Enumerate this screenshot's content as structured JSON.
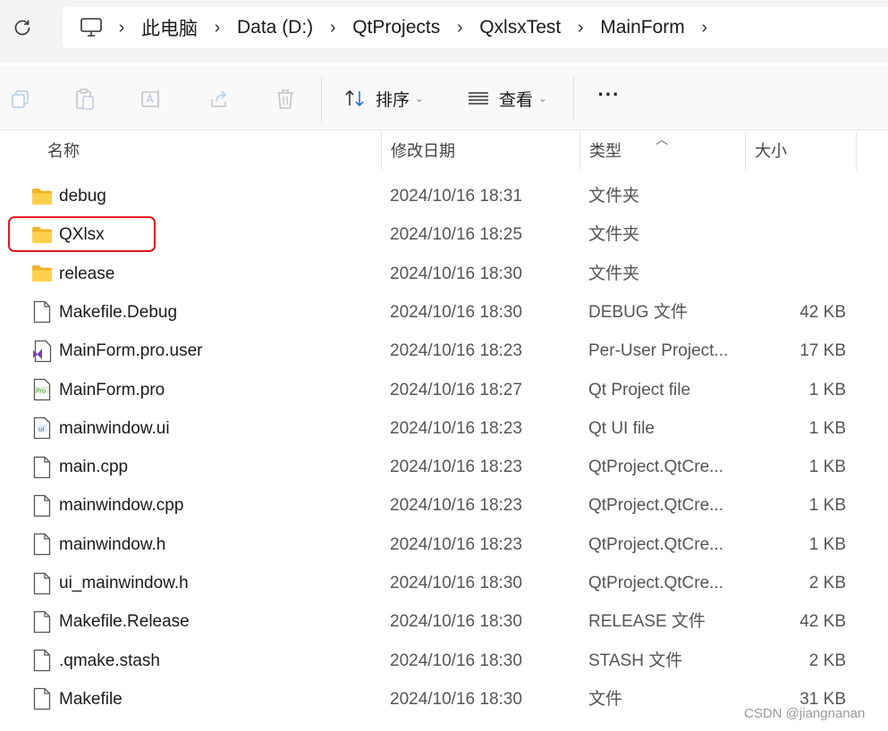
{
  "address": {
    "crumbs": [
      "此电脑",
      "Data (D:)",
      "QtProjects",
      "QxlsxTest",
      "MainForm"
    ]
  },
  "toolbar": {
    "sort_label": "排序",
    "view_label": "查看",
    "more_label": "···"
  },
  "columns": {
    "name": "名称",
    "date": "修改日期",
    "type": "类型",
    "size": "大小"
  },
  "files": [
    {
      "name": "debug",
      "date": "2024/10/16 18:31",
      "type": "文件夹",
      "size": "",
      "icon": "folder-icon"
    },
    {
      "name": "QXlsx",
      "date": "2024/10/16 18:25",
      "type": "文件夹",
      "size": "",
      "icon": "folder-icon"
    },
    {
      "name": "release",
      "date": "2024/10/16 18:30",
      "type": "文件夹",
      "size": "",
      "icon": "folder-icon"
    },
    {
      "name": "Makefile.Debug",
      "date": "2024/10/16 18:30",
      "type": "DEBUG 文件",
      "size": "42 KB",
      "icon": "file-icon"
    },
    {
      "name": "MainForm.pro.user",
      "date": "2024/10/16 18:23",
      "type": "Per-User Project...",
      "size": "17 KB",
      "icon": "visual-studio-file-icon"
    },
    {
      "name": "MainForm.pro",
      "date": "2024/10/16 18:27",
      "type": "Qt Project file",
      "size": "1 KB",
      "icon": "qt-pro-file-icon"
    },
    {
      "name": "mainwindow.ui",
      "date": "2024/10/16 18:23",
      "type": "Qt UI file",
      "size": "1 KB",
      "icon": "qt-ui-file-icon"
    },
    {
      "name": "main.cpp",
      "date": "2024/10/16 18:23",
      "type": "QtProject.QtCre...",
      "size": "1 KB",
      "icon": "file-icon"
    },
    {
      "name": "mainwindow.cpp",
      "date": "2024/10/16 18:23",
      "type": "QtProject.QtCre...",
      "size": "1 KB",
      "icon": "file-icon"
    },
    {
      "name": "mainwindow.h",
      "date": "2024/10/16 18:23",
      "type": "QtProject.QtCre...",
      "size": "1 KB",
      "icon": "file-icon"
    },
    {
      "name": "ui_mainwindow.h",
      "date": "2024/10/16 18:30",
      "type": "QtProject.QtCre...",
      "size": "2 KB",
      "icon": "file-icon"
    },
    {
      "name": "Makefile.Release",
      "date": "2024/10/16 18:30",
      "type": "RELEASE 文件",
      "size": "42 KB",
      "icon": "file-icon"
    },
    {
      "name": ".qmake.stash",
      "date": "2024/10/16 18:30",
      "type": "STASH 文件",
      "size": "2 KB",
      "icon": "file-icon"
    },
    {
      "name": "Makefile",
      "date": "2024/10/16 18:30",
      "type": "文件",
      "size": "31 KB",
      "icon": "file-icon"
    }
  ],
  "highlighted_item": "QXlsx",
  "highlight_color": "#e8141c",
  "folder_color": "#f8c33a",
  "watermark": "CSDN @jiangnanan"
}
